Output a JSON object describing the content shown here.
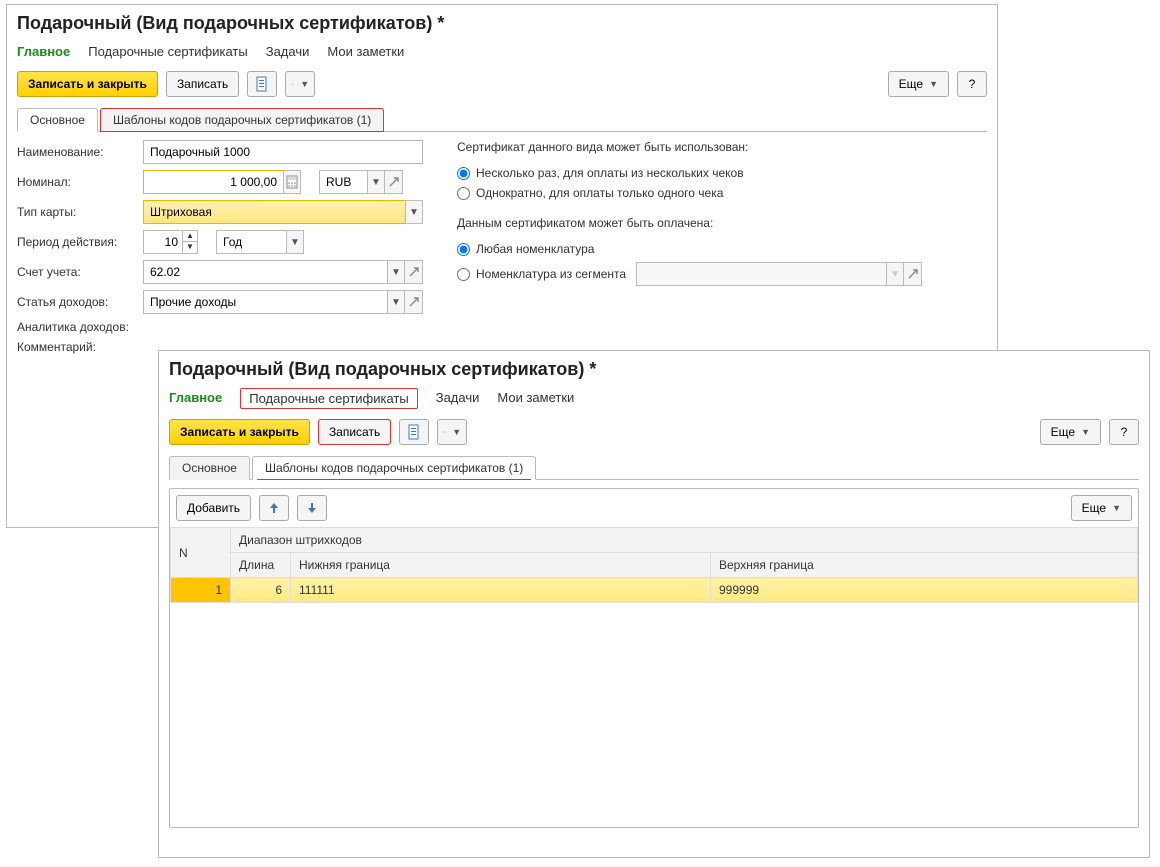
{
  "window1": {
    "title": "Подарочный (Вид подарочных сертификатов) *",
    "nav": {
      "main": "Главное",
      "certs": "Подарочные сертификаты",
      "tasks": "Задачи",
      "notes": "Мои заметки"
    },
    "toolbar": {
      "save_close": "Записать и закрыть",
      "save": "Записать",
      "more": "Еще",
      "help": "?"
    },
    "page_tabs": {
      "main": "Основное",
      "templates": "Шаблоны кодов подарочных сертификатов (1)"
    },
    "form": {
      "name_label": "Наименование:",
      "name_value": "Подарочный 1000",
      "nominal_label": "Номинал:",
      "nominal_value": "1 000,00",
      "currency": "RUB",
      "card_type_label": "Тип карты:",
      "card_type_value": "Штриховая",
      "period_label": "Период действия:",
      "period_value": "10",
      "period_unit": "Год",
      "account_label": "Счет учета:",
      "account_value": "62.02",
      "income_label": "Статья доходов:",
      "income_value": "Прочие доходы",
      "analytics_label": "Аналитика доходов:",
      "comment_label": "Комментарий:"
    },
    "right": {
      "usage_label": "Сертификат данного вида может быть использован:",
      "opt_multiple": "Несколько раз, для оплаты из нескольких чеков",
      "opt_once": "Однократно, для оплаты только одного чека",
      "pay_label": "Данным сертификатом может быть оплачена:",
      "opt_any": "Любая номенклатура",
      "opt_segment": "Номенклатура из сегмента"
    }
  },
  "window2": {
    "title": "Подарочный (Вид подарочных сертификатов) *",
    "nav": {
      "main": "Главное",
      "certs": "Подарочные сертификаты",
      "tasks": "Задачи",
      "notes": "Мои заметки"
    },
    "toolbar": {
      "save_close": "Записать и закрыть",
      "save": "Записать",
      "more": "Еще",
      "help": "?"
    },
    "page_tabs": {
      "main": "Основное",
      "templates": "Шаблоны кодов подарочных сертификатов (1)"
    },
    "table": {
      "add": "Добавить",
      "more": "Еще",
      "col_n": "N",
      "col_range": "Диапазон штрихкодов",
      "col_len": "Длина",
      "col_low": "Нижняя граница",
      "col_high": "Верхняя граница",
      "row": {
        "n": "1",
        "len": "6",
        "low": "111111",
        "high": "999999"
      }
    }
  }
}
